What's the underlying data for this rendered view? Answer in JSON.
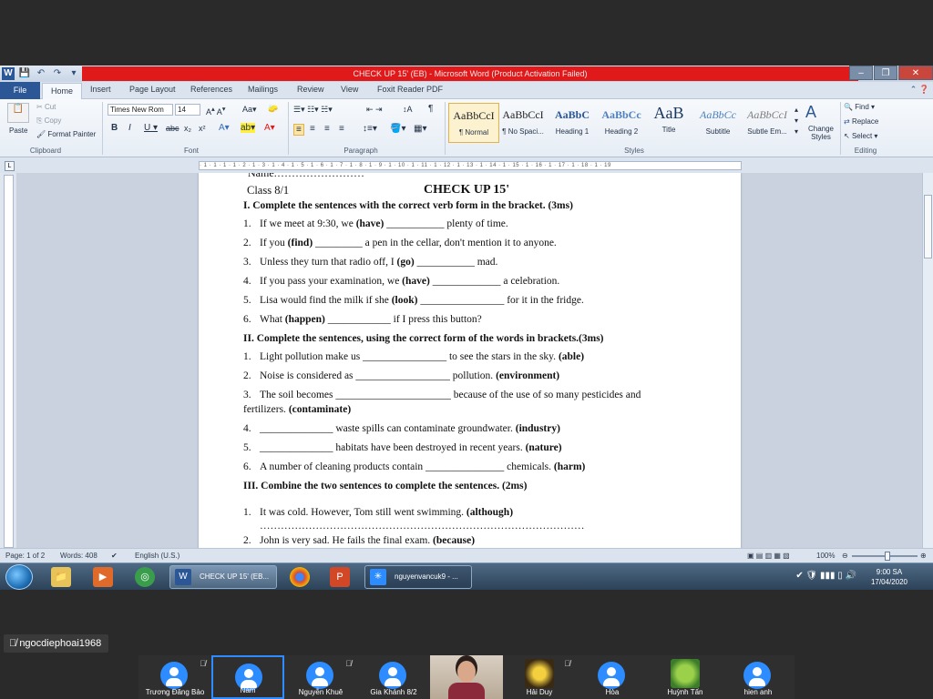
{
  "window": {
    "title": "CHECK UP 15' (EB) - Microsoft Word (Product Activation Failed)"
  },
  "ribbon_tabs": [
    "File",
    "Home",
    "Insert",
    "Page Layout",
    "References",
    "Mailings",
    "Review",
    "View",
    "Foxit Reader PDF"
  ],
  "clipboard": {
    "paste": "Paste",
    "cut": "Cut",
    "copy": "Copy",
    "format_painter": "Format Painter",
    "label": "Clipboard"
  },
  "font": {
    "name": "Times New Rom",
    "size": "14",
    "label": "Font"
  },
  "paragraph": {
    "label": "Paragraph"
  },
  "styles": {
    "label": "Styles",
    "items": [
      {
        "sample": "AaBbCcI",
        "name": "¶ Normal"
      },
      {
        "sample": "AaBbCcI",
        "name": "¶ No Spaci..."
      },
      {
        "sample": "AaBbC",
        "name": "Heading 1"
      },
      {
        "sample": "AaBbCc",
        "name": "Heading 2"
      },
      {
        "sample": "AaB",
        "name": "Title"
      },
      {
        "sample": "AaBbCc",
        "name": "Subtitle"
      },
      {
        "sample": "AaBbCcI",
        "name": "Subtle Em..."
      }
    ],
    "change_styles": "Change Styles"
  },
  "editing": {
    "label": "Editing",
    "find": "Find",
    "replace": "Replace",
    "select": "Select"
  },
  "ruler_text": "· 1 · 1 · 1 · 1 · 2 · 1 · 3 · 1 · 4 · 1 · 5 · 1 · 6 · 1 · 7 · 1 · 8 · 1 · 9 · 1 · 10 · 1 · 11 · 1 · 12 · 1 · 13 · 1 · 14 · 1 · 15 · 1 · 16 · 1 · 17 · 1 · 18 · 1 · 19",
  "document": {
    "top_fragment": "Name:……………………",
    "class_label": "Class 8/1",
    "heading": "CHECK UP 15'",
    "section1_title": "I. Complete the sentences with the correct verb form in the bracket. (3ms)",
    "s1": [
      {
        "n": "1.",
        "pre": "If we meet at 9:30, we ",
        "hint": "(have)",
        "post": " ___________ plenty of time."
      },
      {
        "n": "2.",
        "pre": "If you ",
        "hint": "(find)",
        "post": " _________ a pen in the cellar, don't mention it to anyone."
      },
      {
        "n": "3.",
        "pre": "Unless they turn that radio off, I ",
        "hint": "(go)",
        "post": " ___________ mad."
      },
      {
        "n": "4.",
        "pre": "If you pass your examination, we ",
        "hint": "(have)",
        "post": " _____________ a celebration."
      },
      {
        "n": "5.",
        "pre": "Lisa would find the milk if she ",
        "hint": "(look)",
        "post": " ________________ for it in the fridge."
      },
      {
        "n": "6.",
        "pre": "What ",
        "hint": "(happen)",
        "post": " ____________ if I press this button?"
      }
    ],
    "section2_title": "II. Complete the sentences, using the correct form of the words in brackets.(3ms)",
    "s2": [
      {
        "n": "1.",
        "pre": "Light pollution make us ________________ to see the stars in the sky. ",
        "hint": "(able)"
      },
      {
        "n": "2.",
        "pre": "Noise is considered as __________________ pollution. ",
        "hint": "(environment)"
      },
      {
        "n": "3.",
        "pre": "The soil becomes ______________________ because of the use of so many pesticides and",
        "hint": ""
      },
      {
        "n": "",
        "pre": "fertilizers. ",
        "hint": "(contaminate)"
      },
      {
        "n": "4.",
        "pre": "______________ waste spills can contaminate groundwater. ",
        "hint": "(industry)"
      },
      {
        "n": "5.",
        "pre": "______________ habitats have been destroyed in recent years. ",
        "hint": "(nature)"
      },
      {
        "n": "6.",
        "pre": "A number of cleaning products contain _______________ chemicals. ",
        "hint": "(harm)"
      }
    ],
    "section3_title": "III. Combine the two sentences to complete the sentences. (2ms)",
    "s3": [
      {
        "n": "1.",
        "pre": "It was cold. However, Tom still went swimming. ",
        "hint": "(although)"
      },
      {
        "n": "",
        "pre": "…………………………………………………………………………………",
        "hint": ""
      },
      {
        "n": "2.",
        "pre": "John is very sad. He fails the final exam. ",
        "hint": "(because)"
      }
    ]
  },
  "status": {
    "page": "Page: 1 of 2",
    "words": "Words: 408",
    "language": "English (U.S.)",
    "zoom": "100%"
  },
  "taskbar": {
    "active_task": "CHECK UP 15' (EB...",
    "other_task": "nguyenvancuk9 - ...",
    "clock_time": "9:00 SA",
    "clock_date": "17/04/2020"
  },
  "meeting": {
    "speaker": "ngocdiephoai1968",
    "participants": [
      {
        "name": "Trương Đăng Bảo",
        "muted": true,
        "active": false,
        "kind": "avatar"
      },
      {
        "name": "Nam",
        "muted": false,
        "active": true,
        "kind": "avatar"
      },
      {
        "name": "Nguyễn Khuê",
        "muted": true,
        "active": false,
        "kind": "avatar"
      },
      {
        "name": "Gia Khánh 8/2",
        "muted": false,
        "active": false,
        "kind": "avatar"
      },
      {
        "name": "",
        "muted": false,
        "active": false,
        "kind": "video"
      },
      {
        "name": "Hải Duy",
        "muted": true,
        "active": false,
        "kind": "photo"
      },
      {
        "name": "Hòa",
        "muted": false,
        "active": false,
        "kind": "avatar"
      },
      {
        "name": "Huỳnh Tấn",
        "muted": false,
        "active": false,
        "kind": "photo"
      },
      {
        "name": "hien anh",
        "muted": false,
        "active": false,
        "kind": "avatar"
      }
    ]
  },
  "colors": {
    "title_bar_red": "#e0191b",
    "word_blue": "#2b5797",
    "zoom_blue": "#2d8cff"
  }
}
